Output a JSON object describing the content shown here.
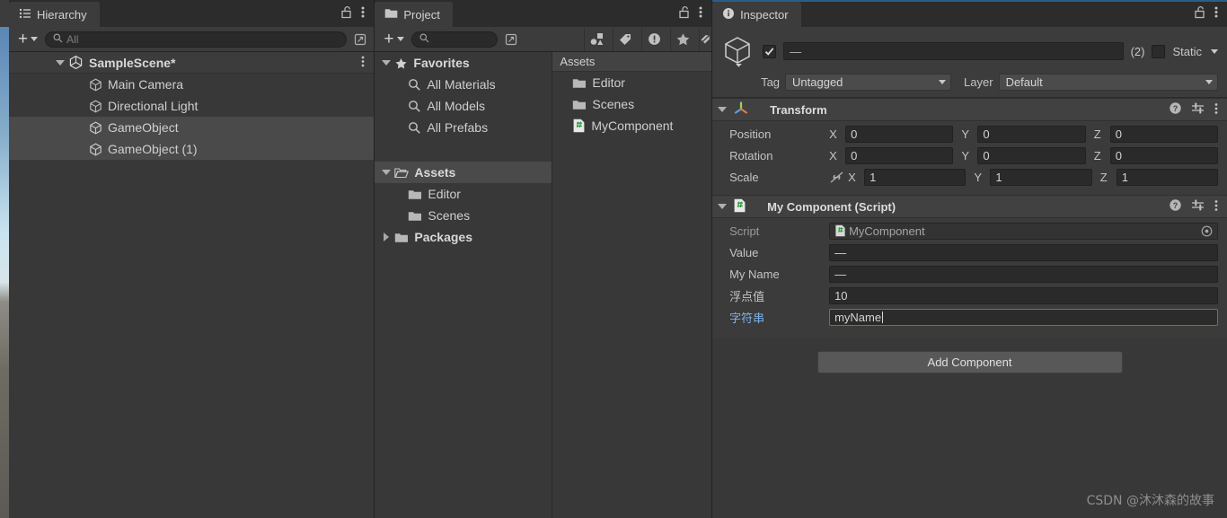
{
  "window": {
    "watermark": "CSDN @沐沐森的故事"
  },
  "hierarchy": {
    "tab_label": "Hierarchy",
    "tab_icon": "hierarchy-list-icon",
    "lock_icon": "lock-open-icon",
    "menu_icon": "kebab-menu-icon",
    "toolbar": {
      "add_label": "+",
      "search_placeholder": "All",
      "search_value": "",
      "search_icon": "search-icon",
      "expand_icon": "open-in-new-icon"
    },
    "scene": {
      "name": "SampleScene*",
      "icon": "unity-scene-icon",
      "expanded": true,
      "menu_icon": "kebab-menu-icon"
    },
    "items": [
      {
        "label": "Main Camera",
        "icon": "gameobject-cube-icon",
        "selected": false
      },
      {
        "label": "Directional Light",
        "icon": "gameobject-cube-icon",
        "selected": false
      },
      {
        "label": "GameObject",
        "icon": "gameobject-cube-icon",
        "selected": true
      },
      {
        "label": "GameObject (1)",
        "icon": "gameobject-cube-icon",
        "selected": true
      }
    ]
  },
  "project": {
    "tab_label": "Project",
    "tab_icon": "folder-icon",
    "lock_icon": "lock-open-icon",
    "menu_icon": "kebab-menu-icon",
    "toolbar": {
      "add_label": "+",
      "search_placeholder": "",
      "search_value": "",
      "search_icon": "search-icon",
      "expand_icon": "open-in-new-icon",
      "filters": [
        {
          "icon": "shapes-filter-icon",
          "name": "filter-by-type"
        },
        {
          "icon": "label-tag-icon",
          "name": "filter-by-label"
        },
        {
          "icon": "warning-exclamation-icon",
          "name": "filter-warnings"
        },
        {
          "icon": "star-icon",
          "name": "filter-favorites"
        },
        {
          "icon": "hidden-tag-icon",
          "name": "filter-hidden"
        }
      ]
    },
    "tree": [
      {
        "label": "Favorites",
        "icon": "star-icon",
        "depth": 0,
        "arrow": "down",
        "bold": true,
        "selected": false
      },
      {
        "label": "All Materials",
        "icon": "search-icon",
        "depth": 1,
        "arrow": "none",
        "bold": false,
        "selected": false
      },
      {
        "label": "All Models",
        "icon": "search-icon",
        "depth": 1,
        "arrow": "none",
        "bold": false,
        "selected": false
      },
      {
        "label": "All Prefabs",
        "icon": "search-icon",
        "depth": 1,
        "arrow": "none",
        "bold": false,
        "selected": false
      },
      {
        "label": "",
        "icon": "none",
        "depth": 0,
        "arrow": "none",
        "bold": false,
        "selected": false
      },
      {
        "label": "Assets",
        "icon": "folder-open-icon",
        "depth": 0,
        "arrow": "down",
        "bold": true,
        "selected": true
      },
      {
        "label": "Editor",
        "icon": "folder-icon",
        "depth": 1,
        "arrow": "none",
        "bold": false,
        "selected": false
      },
      {
        "label": "Scenes",
        "icon": "folder-icon",
        "depth": 1,
        "arrow": "none",
        "bold": false,
        "selected": false
      },
      {
        "label": "Packages",
        "icon": "folder-icon",
        "depth": 0,
        "arrow": "right",
        "bold": true,
        "selected": false
      }
    ],
    "contents": {
      "header": "Assets",
      "items": [
        {
          "label": "Editor",
          "icon": "folder-icon"
        },
        {
          "label": "Scenes",
          "icon": "folder-icon"
        },
        {
          "label": "MyComponent",
          "icon": "csharp-script-icon"
        }
      ]
    }
  },
  "inspector": {
    "tab_label": "Inspector",
    "tab_icon": "info-circle-icon",
    "lock_icon": "lock-open-icon",
    "menu_icon": "kebab-menu-icon",
    "active": true,
    "header": {
      "object_icon": "gameobject-cube-icon",
      "enabled_checkbox": true,
      "name_value": "—",
      "selection_count": "(2)",
      "static_checked": false,
      "static_label": "Static",
      "static_dropdown_icon": "chevron-down-icon",
      "tag_label": "Tag",
      "tag_value": "Untagged",
      "layer_label": "Layer",
      "layer_value": "Default"
    },
    "components": [
      {
        "title": "Transform",
        "icon": "transform-axis-icon",
        "expanded": true,
        "help_icon": "help-circle-icon",
        "preset_icon": "preset-sliders-icon",
        "menu_icon": "kebab-menu-icon",
        "rows": [
          {
            "kind": "vector3",
            "label": "Position",
            "link_icon": "",
            "axes": [
              {
                "axis": "X",
                "value": "0"
              },
              {
                "axis": "Y",
                "value": "0"
              },
              {
                "axis": "Z",
                "value": "0"
              }
            ]
          },
          {
            "kind": "vector3",
            "label": "Rotation",
            "link_icon": "",
            "axes": [
              {
                "axis": "X",
                "value": "0"
              },
              {
                "axis": "Y",
                "value": "0"
              },
              {
                "axis": "Z",
                "value": "0"
              }
            ]
          },
          {
            "kind": "vector3",
            "label": "Scale",
            "link_icon": "link-broken-icon",
            "axes": [
              {
                "axis": "X",
                "value": "1"
              },
              {
                "axis": "Y",
                "value": "1"
              },
              {
                "axis": "Z",
                "value": "1"
              }
            ]
          }
        ]
      },
      {
        "title": "My Component (Script)",
        "icon": "csharp-script-icon",
        "expanded": true,
        "help_icon": "help-circle-icon",
        "preset_icon": "preset-sliders-icon",
        "menu_icon": "kebab-menu-icon",
        "rows": [
          {
            "kind": "objectref",
            "label": "Script",
            "value": "MyComponent",
            "ref_icon": "csharp-script-icon",
            "picker_icon": "object-picker-icon",
            "dim": true
          },
          {
            "kind": "text",
            "label": "Value",
            "value": "—",
            "focused": false,
            "highlight": false
          },
          {
            "kind": "text",
            "label": "My Name",
            "value": "—",
            "focused": false,
            "highlight": false
          },
          {
            "kind": "text",
            "label": "浮点值",
            "value": "10",
            "focused": false,
            "highlight": false
          },
          {
            "kind": "text",
            "label": "字符串",
            "value": "myName",
            "focused": true,
            "highlight": true
          }
        ]
      }
    ],
    "add_component_label": "Add Component"
  },
  "colors": {
    "panel_bg": "#383838",
    "tabbar_bg": "#2c2c2c",
    "tab_bg": "#3c3c3c",
    "field_bg": "#2a2a2a",
    "selection": "#4a4a4a",
    "accent_blue": "#2c5d87",
    "focus_blue": "#3a79c8",
    "label_highlight": "#7fb0e8",
    "csharp_green": "#3a9a45"
  }
}
